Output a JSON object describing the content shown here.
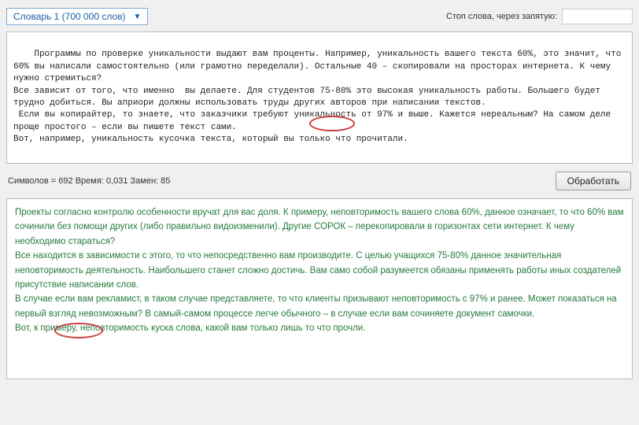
{
  "dropdown": {
    "label": "Словарь 1 (700 000 слов)"
  },
  "stop_words": {
    "label": "Стоп слова, через запятую:",
    "value": ""
  },
  "input_text": "Программы по проверке уникальности выдают вам проценты. Например, уникальность вашего текста 60%, это значит, что 60% вы написали самостоятельно (или грамотно переделали). Остальные 40 – скопировали на просторах интернета. К чему нужно стремиться?\nВсе зависит от того, что именно  вы делаете. Для студентов 75-80% это высокая уникальность работы. Большего будет трудно добиться. Вы априори должны использовать труды других авторов при написании текстов.\n Если вы копирайтер, то знаете, что заказчики требуют уникальность от 97% и выше. Кажется нереальным? На самом деле проще простого – если вы пишете текст сами.\nВот, например, уникальность кусочка текста, который вы только что прочитали.",
  "stats": {
    "chars_label": "Символов = ",
    "chars_value": "692",
    "time_label": "  Время: ",
    "time_value": "0,031",
    "repl_label": "  Замен: ",
    "repl_value": "85"
  },
  "process_button": "Обработать",
  "output_text": {
    "p1": "Проекты согласно контролю особенности вручат для вас доля. К примеру, неповторимость вашего слова 60%, данное означает, то что 60% вам сочинили без помощи других (либо правильно видоизменили). Другие СОРОК – перекопировали в горизонтах сети интернет. К чему необходимо стараться?",
    "p2": "Все находится в зависимости с этого, то что непосредственно вам производите. С целью учащихся 75-80% данное значительная неповторимость деятельность. Наибольшего станет сложно достичь. Вам само собой разумеется обязаны применять работы иных создателей присутствие написании слов.",
    "p3": "В случае если вам рекламист, в таком случае представляете, то что клиенты призывают неповторимость с 97% и ранее. Может показаться на первый взгляд невозможным? В самый-самом процессе легче обычного – в случае если вам сочиняете документ самочки.",
    "p4": "Вот, к примеру, неповторимость куска слова, какой вам только лишь то что прочли."
  }
}
